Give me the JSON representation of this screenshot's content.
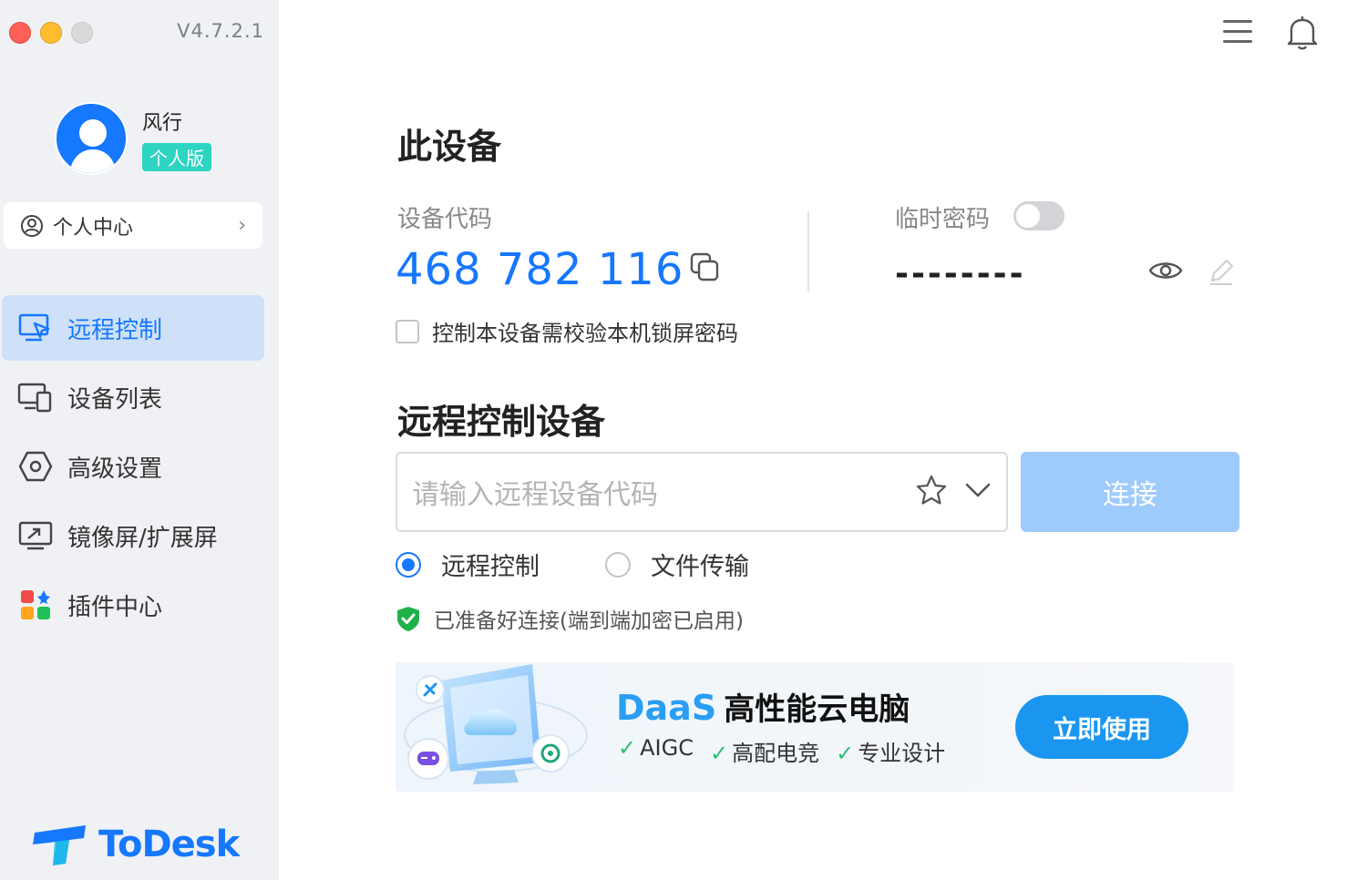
{
  "app": {
    "version": "V4.7.2.1",
    "brand": "ToDesk"
  },
  "user": {
    "name": "风行",
    "plan_badge": "个人版"
  },
  "personal_center": {
    "label": "个人中心"
  },
  "sidebar": {
    "items": [
      {
        "label": "远程控制",
        "icon": "remote-control-icon",
        "active": true
      },
      {
        "label": "设备列表",
        "icon": "device-list-icon",
        "active": false
      },
      {
        "label": "高级设置",
        "icon": "settings-hexagon-icon",
        "active": false
      },
      {
        "label": "镜像屏/扩展屏",
        "icon": "mirror-screen-icon",
        "active": false
      },
      {
        "label": "插件中心",
        "icon": "plugin-grid-icon",
        "active": false
      }
    ]
  },
  "this_device": {
    "title": "此设备",
    "code_label": "设备代码",
    "code": "468 782 116",
    "temp_password_label": "临时密码",
    "temp_password_enabled": false,
    "temp_password_masked": "--------",
    "lock_check_label": "控制本设备需校验本机锁屏密码",
    "lock_check_checked": false
  },
  "remote": {
    "title": "远程控制设备",
    "input_placeholder": "请输入远程设备代码",
    "connect_label": "连接",
    "modes": [
      {
        "label": "远程控制",
        "selected": true
      },
      {
        "label": "文件传输",
        "selected": false
      }
    ],
    "status": "已准备好连接(端到端加密已启用)"
  },
  "banner": {
    "brand": "DaaS",
    "title": "高性能云电脑",
    "tags": [
      "AIGC",
      "高配电竞",
      "专业设计"
    ],
    "cta": "立即使用"
  },
  "colors": {
    "accent": "#1677ff",
    "sidebar_bg": "#eff1f4",
    "active_bg": "#cfe1f8",
    "connect_disabled": "#9ecbfb",
    "cta": "#1a96f0"
  }
}
